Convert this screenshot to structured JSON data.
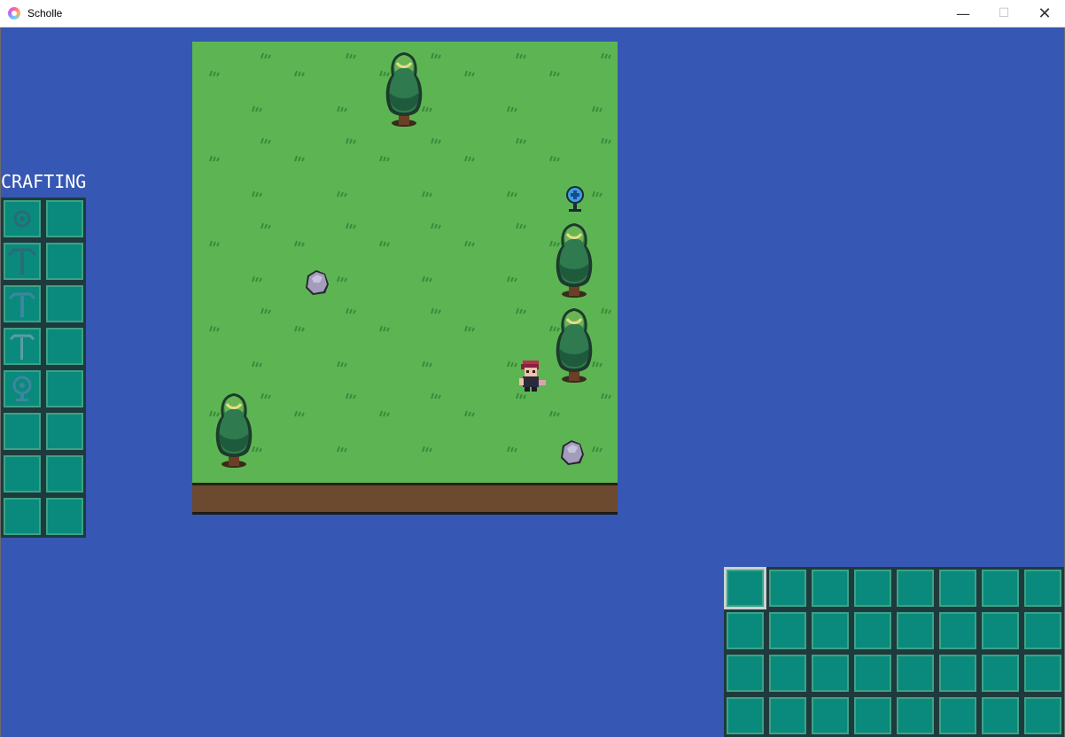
{
  "window": {
    "title": "Scholle",
    "minimize": "—",
    "maximize": "☐",
    "close": "✕"
  },
  "crafting": {
    "label": "CRAFTING",
    "recipes": [
      {
        "icon": "gear-blueprint-icon",
        "output": ""
      },
      {
        "icon": "pickaxe-blueprint-icon",
        "output": ""
      },
      {
        "icon": "pickaxe-blueprint-icon",
        "output": ""
      },
      {
        "icon": "pickaxe-blueprint-icon",
        "output": ""
      },
      {
        "icon": "lamp-blueprint-icon",
        "output": ""
      },
      {
        "icon": "",
        "output": ""
      },
      {
        "icon": "",
        "output": ""
      },
      {
        "icon": "",
        "output": ""
      }
    ]
  },
  "world": {
    "entities": [
      "tree",
      "tree",
      "tree",
      "tree",
      "rock",
      "rock",
      "blue-orb-item",
      "player-character"
    ]
  },
  "inventory": {
    "rows": 4,
    "cols": 8,
    "selected_index": 0
  },
  "colors": {
    "background": "#3657b3",
    "grass": "#5cb552",
    "slot": "#0a8a7c",
    "dirt": "#6b4a2f"
  }
}
